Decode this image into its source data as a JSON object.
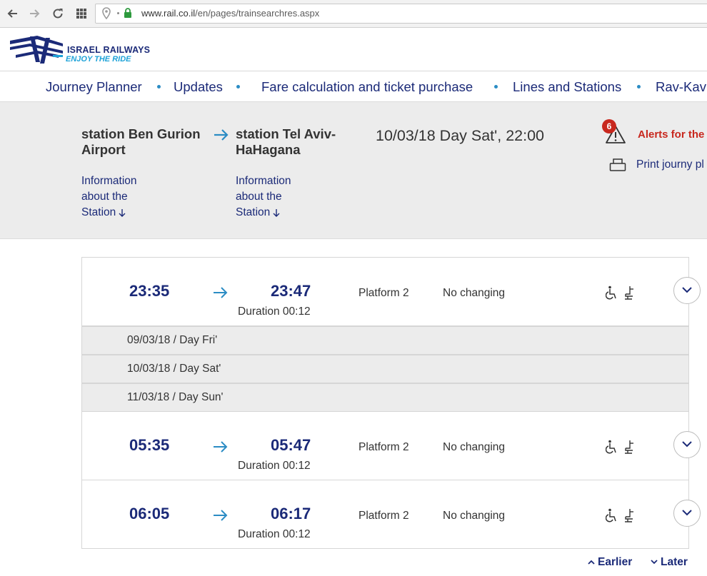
{
  "browser": {
    "url_host": "www.rail.co.il",
    "url_path": "/en/pages/trainsearchres.aspx"
  },
  "header": {
    "logo_title": "ISRAEL RAILWAYS",
    "logo_tagline": "ENJOY THE RIDE"
  },
  "nav": {
    "items": [
      {
        "label": "Journey Planner"
      },
      {
        "label": "Updates"
      },
      {
        "label": "Fare calculation and ticket purchase"
      },
      {
        "label": "Lines and Stations"
      },
      {
        "label": "Rav-Kav"
      }
    ]
  },
  "journey": {
    "origin": {
      "line1": "station Ben Gurion",
      "line2": "Airport"
    },
    "destination": {
      "line1": "station Tel Aviv-",
      "line2": "HaHagana"
    },
    "origin_info": [
      "Information",
      "about the",
      "Station"
    ],
    "destination_info": [
      "Information",
      "about the",
      "Station"
    ],
    "date_time": "10/03/18 Day Sat', 22:00",
    "alerts_count": "6",
    "alerts_label": "Alerts for the",
    "print_label": "Print journy pl"
  },
  "results": [
    {
      "departure": "23:35",
      "arrival": "23:47",
      "duration": "Duration 00:12",
      "platform": "Platform 2",
      "changes": "No changing"
    },
    {
      "departure": "05:35",
      "arrival": "05:47",
      "duration": "Duration 00:12",
      "platform": "Platform 2",
      "changes": "No changing"
    },
    {
      "departure": "06:05",
      "arrival": "06:17",
      "duration": "Duration 00:12",
      "platform": "Platform 2",
      "changes": "No changing"
    }
  ],
  "date_separators": [
    "09/03/18 / Day Fri'",
    "10/03/18 / Day Sat'",
    "11/03/18 / Day Sun'"
  ],
  "pager": {
    "earlier": "Earlier",
    "later": "Later"
  },
  "colors": {
    "brand_navy": "#1b2a78",
    "accent_blue": "#1fa3d8",
    "alert_red": "#c8281e"
  }
}
